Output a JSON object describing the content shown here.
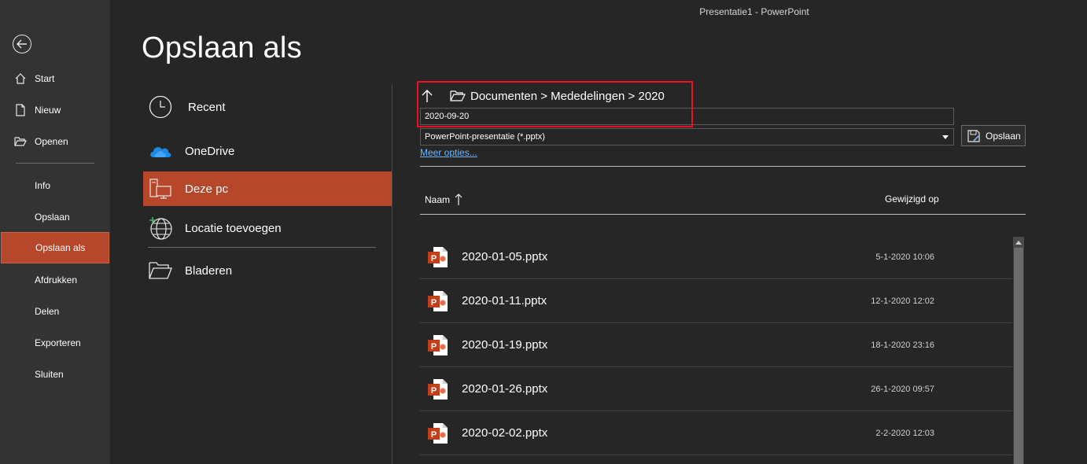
{
  "window": {
    "title": "Presentatie1  -  PowerPoint"
  },
  "nav": {
    "back_icon": "back-arrow-icon",
    "items": [
      {
        "label": "Start",
        "icon": "home-icon"
      },
      {
        "label": "Nieuw",
        "icon": "new-document-icon"
      },
      {
        "label": "Openen",
        "icon": "open-folder-icon"
      },
      {
        "label": "Info"
      },
      {
        "label": "Opslaan"
      },
      {
        "label": "Opslaan als",
        "active": true
      },
      {
        "label": "Afdrukken"
      },
      {
        "label": "Delen"
      },
      {
        "label": "Exporteren"
      },
      {
        "label": "Sluiten"
      }
    ]
  },
  "page": {
    "title": "Opslaan als"
  },
  "locations": [
    {
      "label": "Recent",
      "icon": "clock-icon"
    },
    {
      "label": "OneDrive",
      "icon": "onedrive-cloud-icon"
    },
    {
      "label": "Deze pc",
      "icon": "this-pc-icon",
      "active": true
    },
    {
      "label": "Locatie toevoegen",
      "icon": "add-location-globe-icon"
    },
    {
      "label": "Bladeren",
      "icon": "browse-folder-icon"
    }
  ],
  "save_panel": {
    "path": "Documenten > Mededelingen > 2020",
    "filename_value": "2020-09-20",
    "filetype_value": "PowerPoint-presentatie (*.pptx)",
    "save_label": "Opslaan",
    "more_options": "Meer opties...",
    "columns": {
      "name": "Naam",
      "modified": "Gewijzigd op"
    }
  },
  "files": [
    {
      "name": "2020-01-05.pptx",
      "modified": "5-1-2020 10:06"
    },
    {
      "name": "2020-01-11.pptx",
      "modified": "12-1-2020 12:02"
    },
    {
      "name": "2020-01-19.pptx",
      "modified": "18-1-2020 23:16"
    },
    {
      "name": "2020-01-26.pptx",
      "modified": "26-1-2020 09:57"
    },
    {
      "name": "2020-02-02.pptx",
      "modified": "2-2-2020 12:03"
    }
  ],
  "colors": {
    "accent": "#b7472a",
    "highlight": "#e81123",
    "link": "#6cb6ff"
  }
}
